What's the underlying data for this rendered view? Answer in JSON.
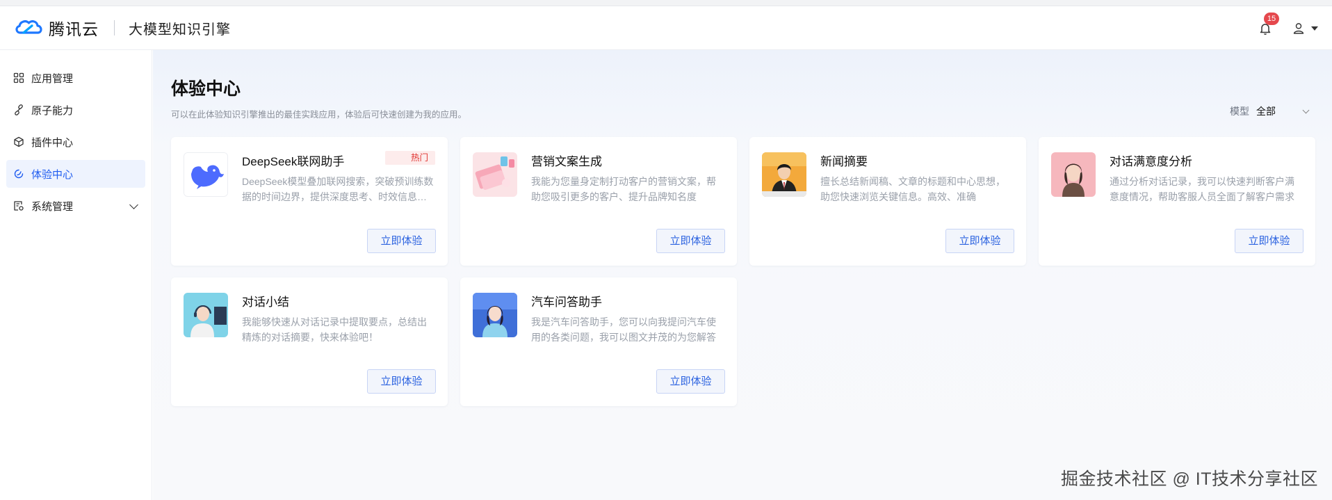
{
  "header": {
    "brand": "腾讯云",
    "product": "大模型知识引擎",
    "notification_count": "15"
  },
  "sidebar": {
    "items": [
      {
        "label": "应用管理",
        "icon": "grid-icon"
      },
      {
        "label": "原子能力",
        "icon": "link-icon"
      },
      {
        "label": "插件中心",
        "icon": "cube-icon"
      },
      {
        "label": "体验中心",
        "icon": "experience-icon",
        "active": true
      },
      {
        "label": "系统管理",
        "icon": "settings-doc-icon",
        "expandable": true
      }
    ]
  },
  "page": {
    "title": "体验中心",
    "description": "可以在此体验知识引擎推出的最佳实践应用，体验后可快速创建为我的应用。",
    "filter_label": "模型",
    "filter_value": "全部"
  },
  "cards": [
    {
      "title": "DeepSeek联网助手",
      "tag": "热门",
      "desc": "DeepSeek模型叠加联网搜索，突破预训练数据的时间边界，提供深度思考、时效信息的回答",
      "button": "立即体验",
      "image": "deepseek-whale"
    },
    {
      "title": "营销文案生成",
      "desc": "我能为您量身定制打动客户的营销文案，帮助您吸引更多的客户、提升品牌知名度",
      "button": "立即体验",
      "image": "marketing-products"
    },
    {
      "title": "新闻摘要",
      "desc": "擅长总结新闻稿、文章的标题和中心思想，助您快速浏览关键信息。高效、准确",
      "button": "立即体验",
      "image": "news-anchor"
    },
    {
      "title": "对话满意度分析",
      "desc": "通过分析对话记录，我可以快速判断客户满意度情况，帮助客服人员全面了解客户需求",
      "button": "立即体验",
      "image": "service-woman"
    },
    {
      "title": "对话小结",
      "desc": "我能够快速从对话记录中提取要点，总结出精炼的对话摘要，快来体验吧！",
      "button": "立即体验",
      "image": "headset-agent"
    },
    {
      "title": "汽车问答助手",
      "desc": "我是汽车问答助手，您可以向我提问汽车使用的各类问题，我可以图文并茂的为您解答",
      "button": "立即体验",
      "image": "car-assistant"
    }
  ],
  "watermark": "掘金技术社区 @ IT技术分享社区",
  "colors": {
    "accent": "#1f5cf0",
    "hot_tag": "#e0332f",
    "badge": "#e5484d"
  }
}
